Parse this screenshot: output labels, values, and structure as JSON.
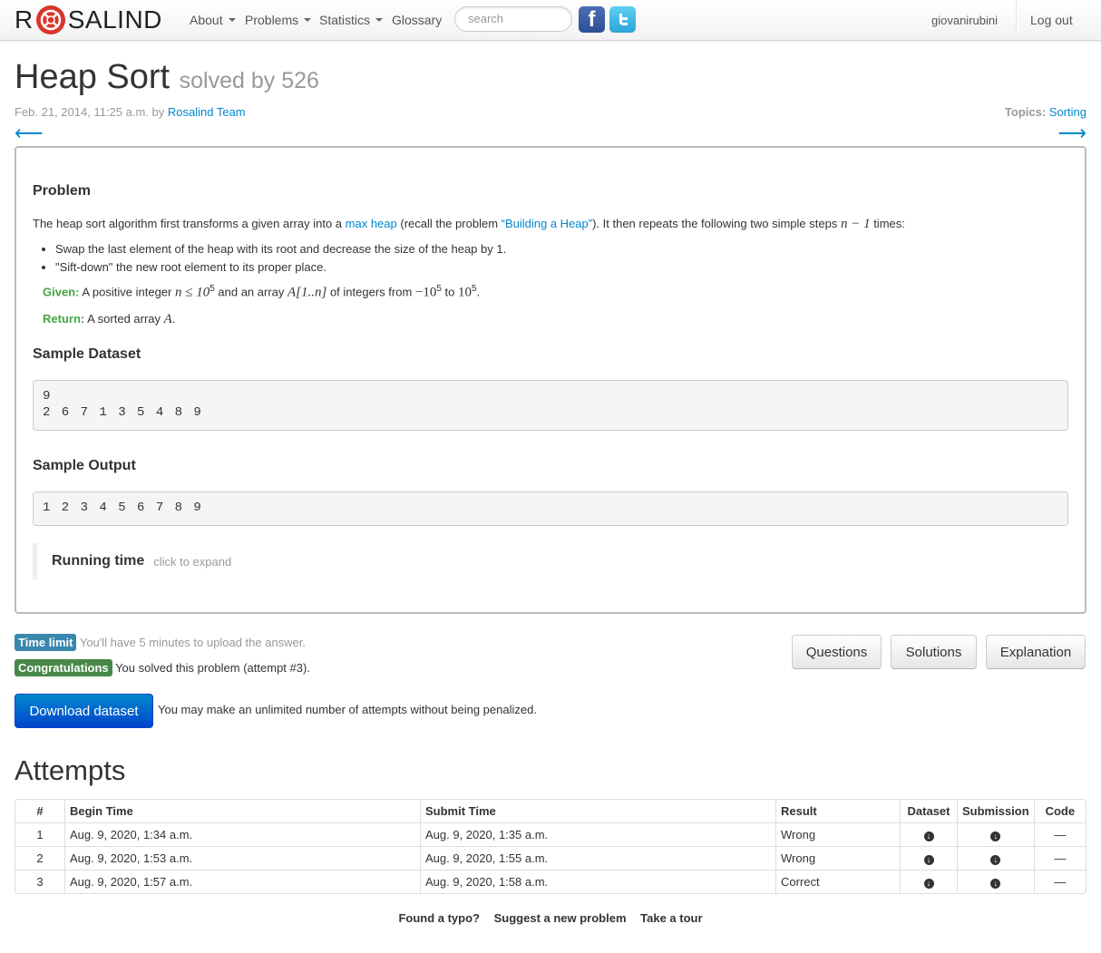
{
  "navbar": {
    "brand_r": "R",
    "brand_rest": "SALIND",
    "menu": [
      {
        "label": "About",
        "dropdown": true
      },
      {
        "label": "Problems",
        "dropdown": true
      },
      {
        "label": "Statistics",
        "dropdown": true
      },
      {
        "label": "Glossary",
        "dropdown": false
      }
    ],
    "search_placeholder": "search",
    "facebook": "f",
    "twitter": "t",
    "username": "giovanirubini",
    "logout": "Log out"
  },
  "problem": {
    "title": "Heap Sort",
    "solved_by": "solved by 526",
    "date": "Feb. 21, 2014, 11:25 a.m. by ",
    "author": "Rosalind Team",
    "topics_label": "Topics:",
    "topic": "Sorting",
    "prev_arrow": "⟵",
    "next_arrow": "⟶",
    "section_problem": "Problem",
    "intro_1": "The heap sort algorithm first transforms a given array into a ",
    "intro_link": "max heap",
    "intro_2": " (recall the problem ",
    "intro_link2": "“Building a Heap”",
    "intro_3": "). It then repeats the following two simple steps ",
    "intro_math": "n − 1",
    "intro_4": " times:",
    "steps": [
      "Swap the last element of the heap with its root and decrease the size of the heap by 1.",
      "\"Sift-down\" the new root element to its proper place."
    ],
    "given_label": "Given:",
    "given_text_1": " A positive integer ",
    "given_math_1": "n ≤ 10",
    "given_sup_1": "5",
    "given_text_2": " and an array ",
    "given_math_2": "A[1..n]",
    "given_text_3": " of integers from ",
    "given_math_3": "−10",
    "given_sup_3": "5",
    "given_text_4": " to ",
    "given_math_4": "10",
    "given_sup_4": "5",
    "given_text_5": ".",
    "return_label": "Return:",
    "return_text": " A sorted array ",
    "return_math": "A",
    "return_end": ".",
    "sample_dataset_label": "Sample Dataset",
    "sample_dataset": "9\n2 6 7 1 3 5 4 8 9",
    "sample_output_label": "Sample Output",
    "sample_output": "1 2 3 4 5 6 7 8 9",
    "running_time": "Running time",
    "running_hint": "click to expand"
  },
  "status": {
    "time_limit_label": "Time limit",
    "time_limit_text": "You'll have 5 minutes to upload the answer.",
    "congrats_label": "Congratulations",
    "congrats_text": "You solved this problem (attempt #3).",
    "download_button": "Download dataset",
    "download_note": "You may make an unlimited number of attempts without being penalized."
  },
  "buttons": {
    "questions": "Questions",
    "solutions": "Solutions",
    "explanation": "Explanation"
  },
  "attempts": {
    "heading": "Attempts",
    "columns": [
      "#",
      "Begin Time",
      "Submit Time",
      "Result",
      "Dataset",
      "Submission",
      "Code"
    ],
    "rows": [
      {
        "num": "1",
        "begin": "Aug. 9, 2020, 1:34 a.m.",
        "submit": "Aug. 9, 2020, 1:35 a.m.",
        "result": "Wrong",
        "code": "—"
      },
      {
        "num": "2",
        "begin": "Aug. 9, 2020, 1:53 a.m.",
        "submit": "Aug. 9, 2020, 1:55 a.m.",
        "result": "Wrong",
        "code": "—"
      },
      {
        "num": "3",
        "begin": "Aug. 9, 2020, 1:57 a.m.",
        "submit": "Aug. 9, 2020, 1:58 a.m.",
        "result": "Correct",
        "code": "—"
      }
    ]
  },
  "footer": {
    "typo": "Found a typo?",
    "suggest": "Suggest a new problem",
    "tour": "Take a tour"
  },
  "colors": {
    "link": "#0088cc",
    "green_label": "#468847",
    "info_label": "#3a87ad",
    "primary_button": "#0044cc",
    "logo_red": "#d9362b"
  }
}
